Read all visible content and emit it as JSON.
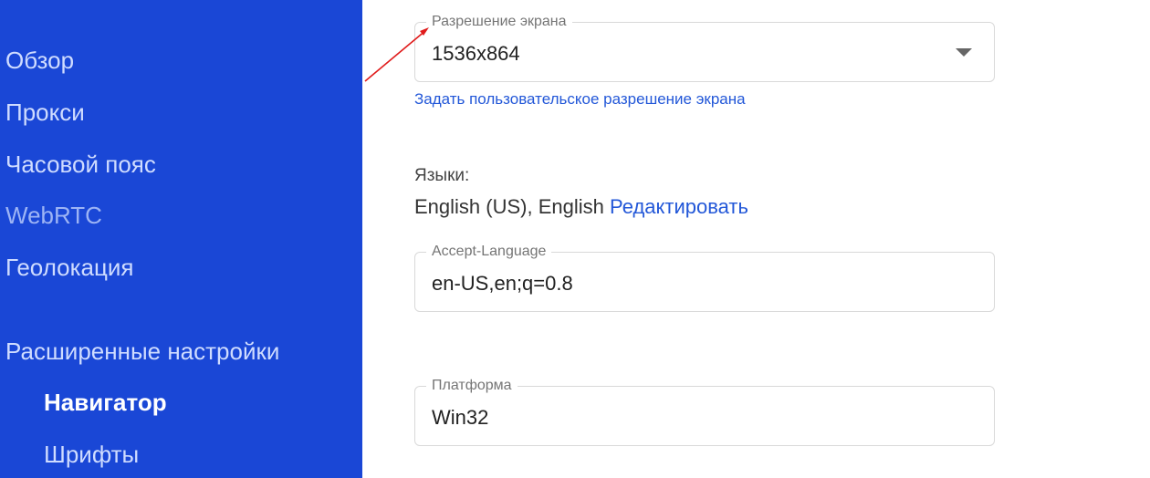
{
  "sidebar": {
    "items": [
      {
        "label": "Обзор"
      },
      {
        "label": "Прокси"
      },
      {
        "label": "Часовой пояс"
      },
      {
        "label": "WebRTC"
      },
      {
        "label": "Геолокация"
      }
    ],
    "advanced": {
      "label": "Расширенные настройки",
      "subitems": [
        {
          "label": "Навигатор",
          "active": true
        },
        {
          "label": "Шрифты",
          "active": false
        }
      ]
    }
  },
  "main": {
    "resolution": {
      "label": "Разрешение экрана",
      "value": "1536x864",
      "custom_link": "Задать пользовательское разрешение экрана"
    },
    "languages": {
      "label": "Языки:",
      "value": "English (US), English",
      "edit_link": "Редактировать"
    },
    "accept_language": {
      "label": "Accept-Language",
      "value": "en-US,en;q=0.8"
    },
    "platform": {
      "label": "Платформа",
      "value": "Win32"
    }
  },
  "colors": {
    "sidebar_bg": "#1a47d6",
    "link": "#2257d8",
    "annotation_arrow": "#e01b1b"
  }
}
